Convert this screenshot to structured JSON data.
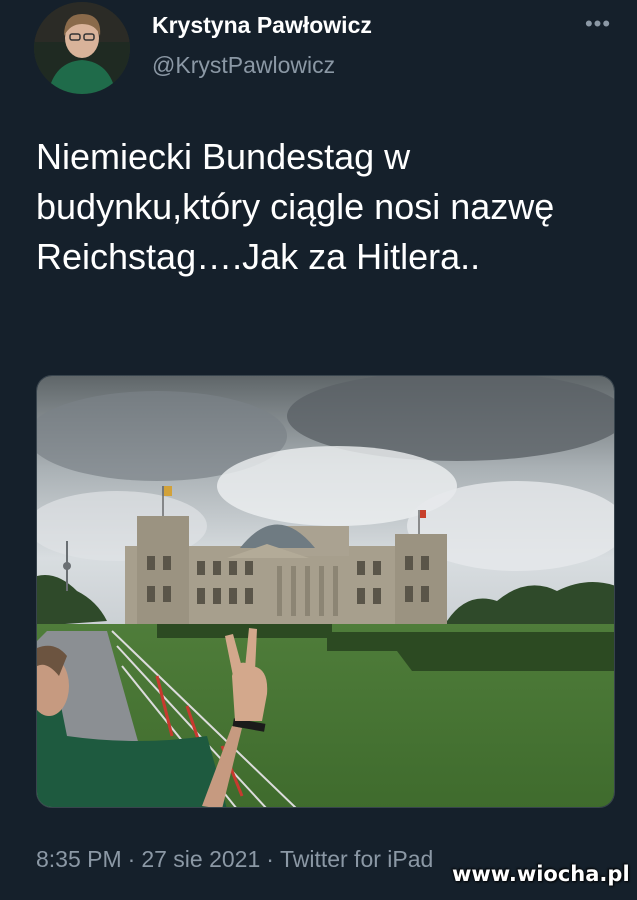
{
  "author": {
    "display_name": "Krystyna Pawłowicz",
    "handle": "@KrystPawlowicz",
    "avatar_icon": "person-avatar"
  },
  "header": {
    "more_label": "•••",
    "more_icon": "more-dots-icon"
  },
  "tweet": {
    "text": "Niemiecki Bundestag w budynku,który ciągle nosi nazwę Reichstag….Jak za Hitlera..",
    "media_description_icon": "photo-reichstag"
  },
  "meta": {
    "time": "8:35 PM",
    "sep1": "·",
    "date": "27 sie 2021",
    "sep2": "·",
    "source": "Twitter for iPad"
  },
  "watermark": "www.wiocha.pl",
  "colors": {
    "background": "#15202b",
    "text_primary": "#ffffff",
    "text_secondary": "#8b98a5"
  }
}
